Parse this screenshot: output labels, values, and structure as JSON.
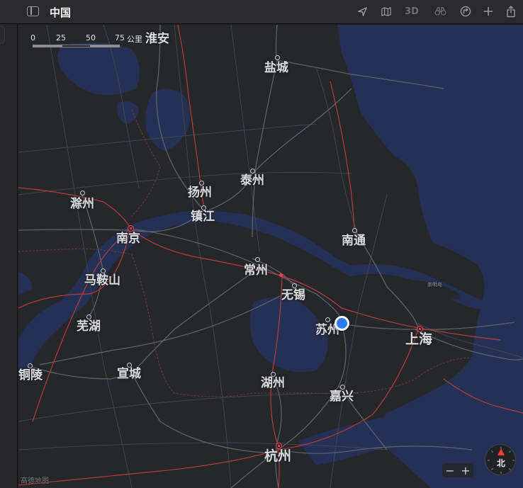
{
  "window": {
    "title": "中国"
  },
  "toolbar": {
    "three_d_label": "3D"
  },
  "scale": {
    "ticks": [
      "0",
      "25",
      "50",
      "75"
    ],
    "unit": "公里"
  },
  "cities": {
    "huaian": "淮安",
    "yancheng": "盐城",
    "taizhou": "泰州",
    "yangzhou": "扬州",
    "chuzhou": "滁州",
    "zhenjiang": "镇江",
    "nanjing": "南京",
    "nantong": "南通",
    "changzhou": "常州",
    "maanshan": "马鞍山",
    "wuxi": "无锡",
    "chongming": "崇明岛",
    "suzhou": "苏州",
    "shanghai": "上海",
    "wuhu": "芜湖",
    "tongling": "铜陵",
    "xuancheng": "宣城",
    "huzhou": "湖州",
    "jiaxing": "嘉兴",
    "hangzhou": "杭州"
  },
  "compass": {
    "north_label": "北"
  },
  "zoom": {
    "out": "−",
    "in": "+"
  },
  "attribution": "高德地图",
  "colors": {
    "water": "#243154",
    "land": "#26272a",
    "road": "#5b6270",
    "rail": "#b83c3c",
    "user_location": "#2d7cf6"
  }
}
